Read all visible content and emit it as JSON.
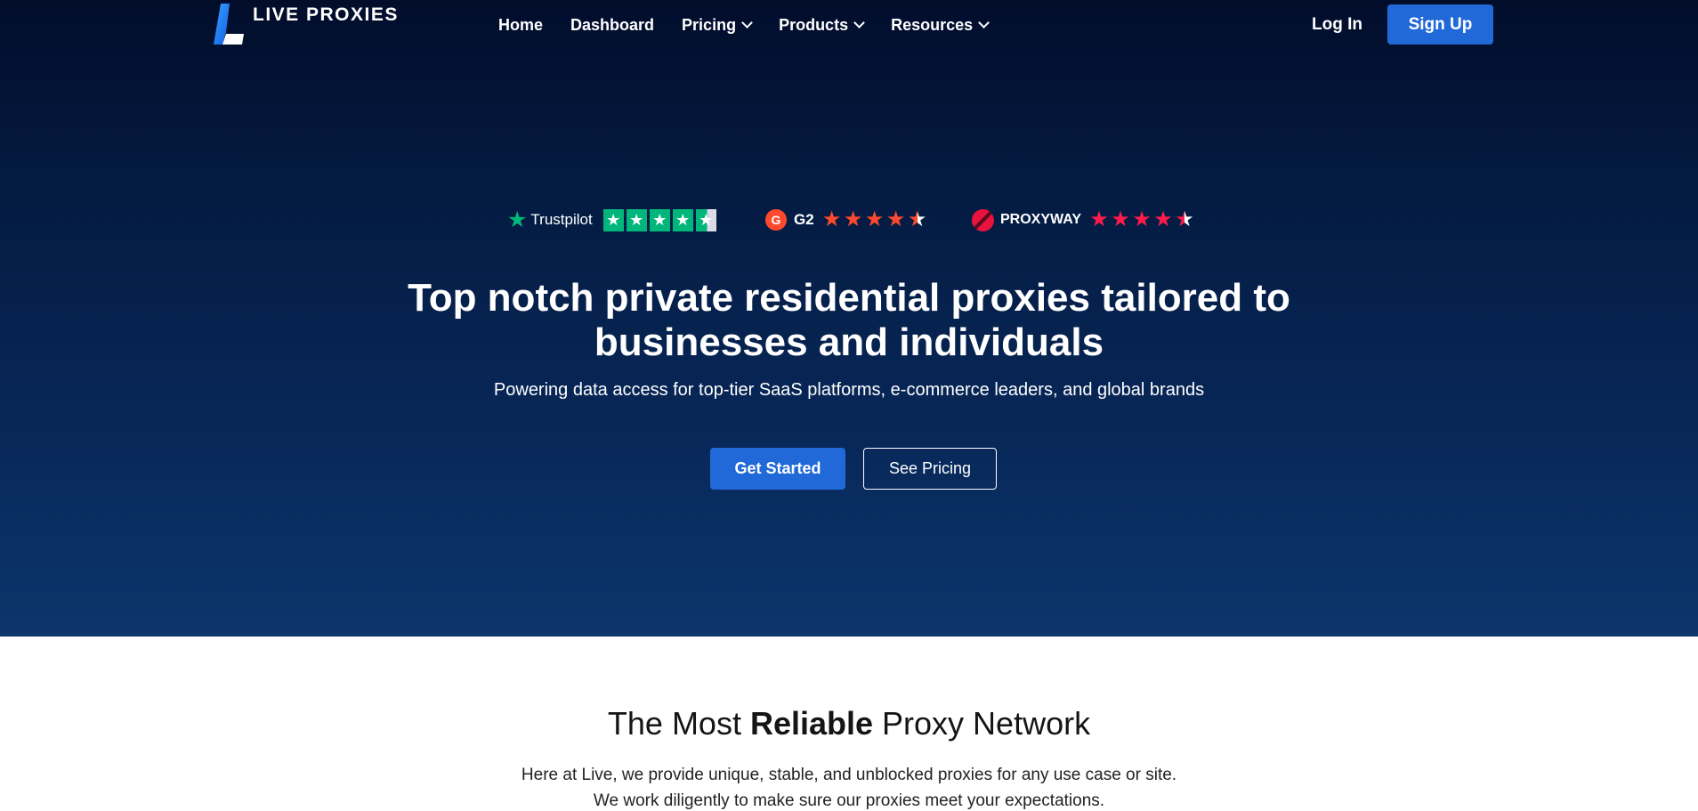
{
  "brand": {
    "name": "LIVE PROXIES"
  },
  "nav": {
    "items": [
      {
        "label": "Home"
      },
      {
        "label": "Dashboard"
      },
      {
        "label": "Pricing",
        "has_dropdown": true
      },
      {
        "label": "Products",
        "has_dropdown": true
      },
      {
        "label": "Resources",
        "has_dropdown": true
      }
    ],
    "login_label": "Log In",
    "signup_label": "Sign Up"
  },
  "ratings": [
    {
      "platform": "Trustpilot",
      "stars": 4.5,
      "color": "#00b67a"
    },
    {
      "platform": "G2",
      "stars": 4.5,
      "color": "#ff492c"
    },
    {
      "platform": "PROXYWAY",
      "stars": 4.5,
      "color": "#ff1b4b"
    }
  ],
  "hero": {
    "title": "Top notch private residential proxies tailored to businesses and individuals",
    "subtitle": "Powering data access for top-tier SaaS platforms, e-commerce leaders, and global brands",
    "primary_cta": "Get Started",
    "secondary_cta": "See Pricing"
  },
  "section": {
    "title_pre": "The Most ",
    "title_bold": "Reliable",
    "title_post": " Proxy Network",
    "paragraph_1": "Here at Live, we provide unique, stable, and unblocked proxies for any use case or site.",
    "paragraph_2": "We work diligently to make sure our proxies meet your expectations."
  },
  "colors": {
    "accent": "#2169d8",
    "hero_top": "#020d2b",
    "hero_bottom": "#0c366c"
  }
}
